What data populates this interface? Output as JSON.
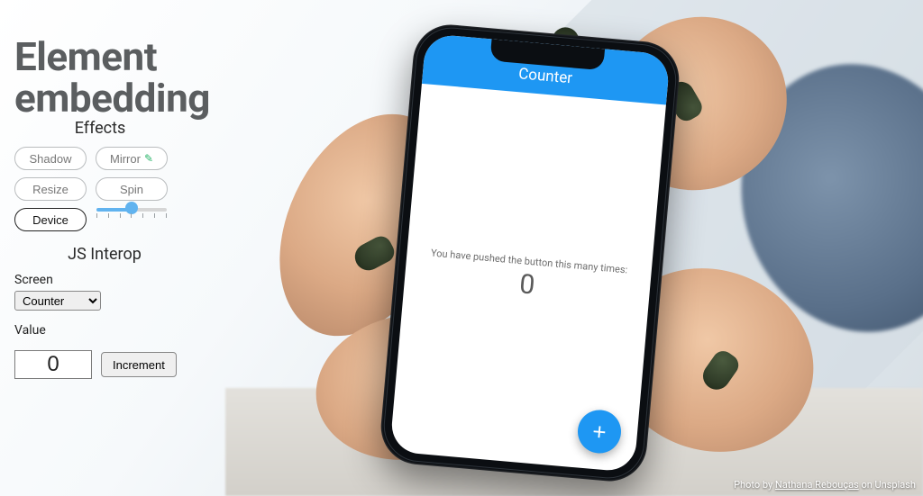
{
  "title_line1": "Element",
  "title_line2": "embedding",
  "effects": {
    "heading": "Effects",
    "shadow": "Shadow",
    "mirror": "Mirror",
    "resize": "Resize",
    "spin": "Spin",
    "device": "Device",
    "spin_value": 0.5
  },
  "jsinterop": {
    "heading": "JS Interop",
    "screen_label": "Screen",
    "screen_options": [
      "Counter"
    ],
    "screen_selected": "Counter",
    "value_label": "Value",
    "value": "0",
    "increment_label": "Increment"
  },
  "app": {
    "appbar_title": "Counter",
    "push_text": "You have pushed the button this many times:",
    "count": "0",
    "fab_glyph": "+"
  },
  "credit": {
    "prefix": "Photo by ",
    "author": "Nathana Rebouças",
    "suffix": " on Unsplash"
  }
}
